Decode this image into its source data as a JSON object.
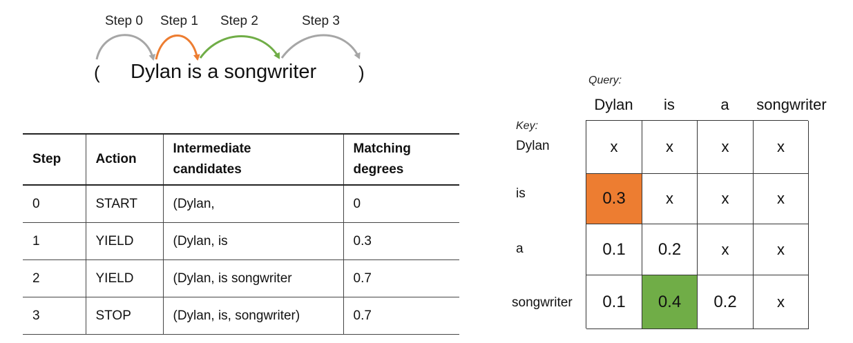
{
  "steps_diagram": {
    "step_labels": [
      "Step 0",
      "Step 1",
      "Step 2",
      "Step 3"
    ],
    "open_paren": "(",
    "sentence": "Dylan is a songwriter",
    "close_paren": ")",
    "arc_colors": [
      "#a6a6a6",
      "#ed7d31",
      "#70ad47",
      "#a6a6a6"
    ]
  },
  "table": {
    "headers": [
      "Step",
      "Action",
      "Intermediate candidates",
      "Matching degrees"
    ],
    "rows": [
      [
        "0",
        "START",
        "(Dylan,",
        "0"
      ],
      [
        "1",
        "YIELD",
        "(Dylan, is",
        "0.3"
      ],
      [
        "2",
        "YIELD",
        "(Dylan, is songwriter",
        "0.7"
      ],
      [
        "3",
        "STOP",
        "(Dylan, is, songwriter)",
        "0.7"
      ]
    ]
  },
  "matrix": {
    "query_label": "Query:",
    "key_label": "Key:",
    "query_tokens": [
      "Dylan",
      "is",
      "a",
      "songwriter"
    ],
    "key_tokens": [
      "Dylan",
      "is",
      "a",
      "songwriter"
    ],
    "cells": [
      [
        "x",
        "x",
        "x",
        "x"
      ],
      [
        "0.3",
        "x",
        "x",
        "x"
      ],
      [
        "0.1",
        "0.2",
        "x",
        "x"
      ],
      [
        "0.1",
        "0.4",
        "0.2",
        "x"
      ]
    ],
    "highlight_colors": {
      "orange": "#ed7d31",
      "green": "#70ad47"
    }
  }
}
